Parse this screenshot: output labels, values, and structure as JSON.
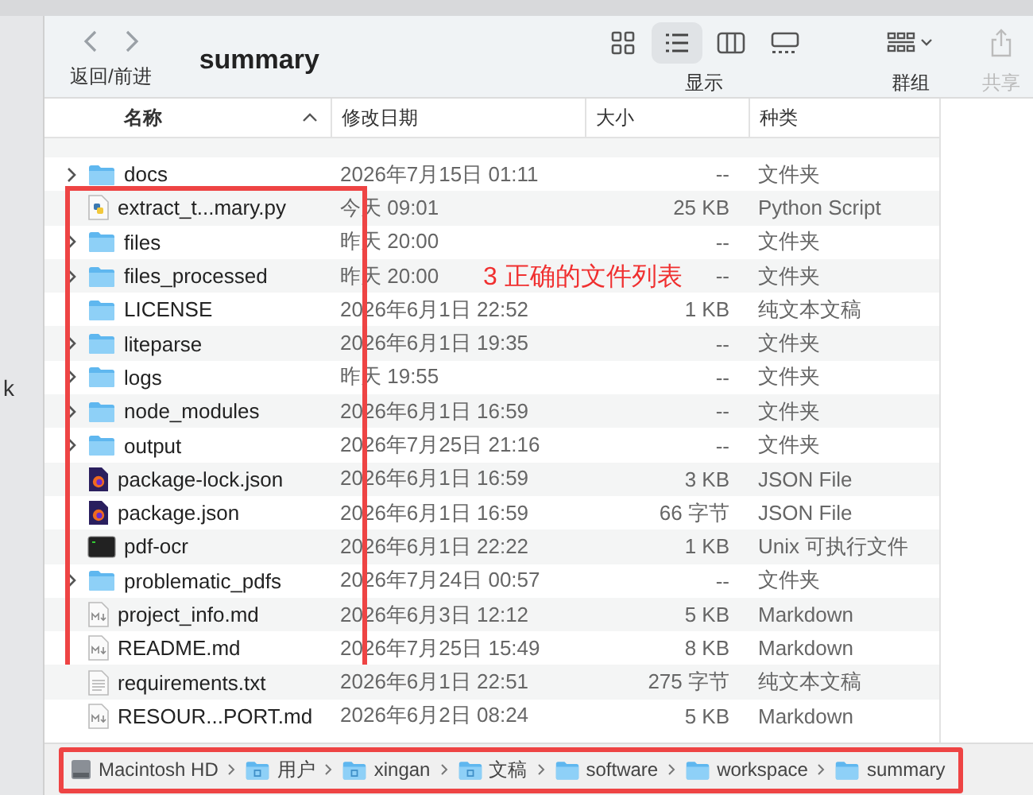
{
  "background_fragment": "k",
  "toolbar": {
    "back_forward_label": "返回/前进",
    "title": "summary",
    "view_label": "显示",
    "views": [
      {
        "kind": "icons",
        "selected": false
      },
      {
        "kind": "list",
        "selected": true
      },
      {
        "kind": "columns",
        "selected": false
      },
      {
        "kind": "gallery",
        "selected": false
      }
    ],
    "group_label": "群组",
    "share_label": "共享",
    "share_disabled": true
  },
  "table": {
    "columns": [
      {
        "label": "名称",
        "sorted": true
      },
      {
        "label": "修改日期",
        "sorted": false
      },
      {
        "label": "大小",
        "sorted": false
      },
      {
        "label": "种类",
        "sorted": false
      }
    ],
    "rows": [
      {
        "name": "docs",
        "date": "2026年7月15日 01:11",
        "size": "--",
        "kind_text": "文件夹",
        "kind": "folder",
        "expandable": true,
        "highlighted": false
      },
      {
        "name": "extract_t...mary.py",
        "date": "今天 09:01",
        "size": "25 KB",
        "kind_text": "Python Script",
        "kind": "python",
        "expandable": false,
        "highlighted": true
      },
      {
        "name": "files",
        "date": "昨天 20:00",
        "size": "--",
        "kind_text": "文件夹",
        "kind": "folder",
        "expandable": true,
        "highlighted": true
      },
      {
        "name": "files_processed",
        "date": "昨天 20:00",
        "size": "--",
        "kind_text": "文件夹",
        "kind": "folder",
        "expandable": true,
        "highlighted": true
      },
      {
        "name": "LICENSE",
        "date": "2026年6月1日 22:52",
        "size": "1 KB",
        "kind_text": "纯文本文稿",
        "kind": "folder",
        "expandable": false,
        "highlighted": true
      },
      {
        "name": "liteparse",
        "date": "2026年6月1日 19:35",
        "size": "--",
        "kind_text": "文件夹",
        "kind": "folder",
        "expandable": true,
        "highlighted": true
      },
      {
        "name": "logs",
        "date": "昨天 19:55",
        "size": "--",
        "kind_text": "文件夹",
        "kind": "folder",
        "expandable": true,
        "highlighted": true
      },
      {
        "name": "node_modules",
        "date": "2026年6月1日 16:59",
        "size": "--",
        "kind_text": "文件夹",
        "kind": "folder",
        "expandable": true,
        "highlighted": true
      },
      {
        "name": "output",
        "date": "2026年7月25日 21:16",
        "size": "--",
        "kind_text": "文件夹",
        "kind": "folder",
        "expandable": true,
        "highlighted": true
      },
      {
        "name": "package-lock.json",
        "date": "2026年6月1日 16:59",
        "size": "3 KB",
        "kind_text": "JSON File",
        "kind": "json",
        "expandable": false,
        "highlighted": true
      },
      {
        "name": "package.json",
        "date": "2026年6月1日 16:59",
        "size": "66 字节",
        "kind_text": "JSON File",
        "kind": "json",
        "expandable": false,
        "highlighted": true
      },
      {
        "name": "pdf-ocr",
        "date": "2026年6月1日 22:22",
        "size": "1 KB",
        "kind_text": "Unix 可执行文件",
        "kind": "exec",
        "expandable": false,
        "highlighted": true
      },
      {
        "name": "problematic_pdfs",
        "date": "2026年7月24日 00:57",
        "size": "--",
        "kind_text": "文件夹",
        "kind": "folder",
        "expandable": true,
        "highlighted": true
      },
      {
        "name": "project_info.md",
        "date": "2026年6月3日 12:12",
        "size": "5 KB",
        "kind_text": "Markdown",
        "kind": "markdown",
        "expandable": false,
        "highlighted": true
      },
      {
        "name": "README.md",
        "date": "2026年7月25日 15:49",
        "size": "8 KB",
        "kind_text": "Markdown",
        "kind": "markdown",
        "expandable": false,
        "highlighted": true
      },
      {
        "name": "requirements.txt",
        "date": "2026年6月1日 22:51",
        "size": "275 字节",
        "kind_text": "纯文本文稿",
        "kind": "text",
        "expandable": false,
        "highlighted": false
      },
      {
        "name": "RESOUR...PORT.md",
        "date": "2026年6月2日 08:24",
        "size": "5 KB",
        "kind_text": "Markdown",
        "kind": "markdown",
        "expandable": false,
        "highlighted": false
      }
    ]
  },
  "annotation": {
    "label": "3 正确的文件列表"
  },
  "path_bar": {
    "highlighted": true,
    "items": [
      {
        "label": "Macintosh HD",
        "kind": "disk"
      },
      {
        "label": "用户",
        "kind": "users"
      },
      {
        "label": "xingan",
        "kind": "home"
      },
      {
        "label": "文稿",
        "kind": "docs"
      },
      {
        "label": "software",
        "kind": "folder"
      },
      {
        "label": "workspace",
        "kind": "folder"
      },
      {
        "label": "summary",
        "kind": "folder"
      }
    ]
  }
}
